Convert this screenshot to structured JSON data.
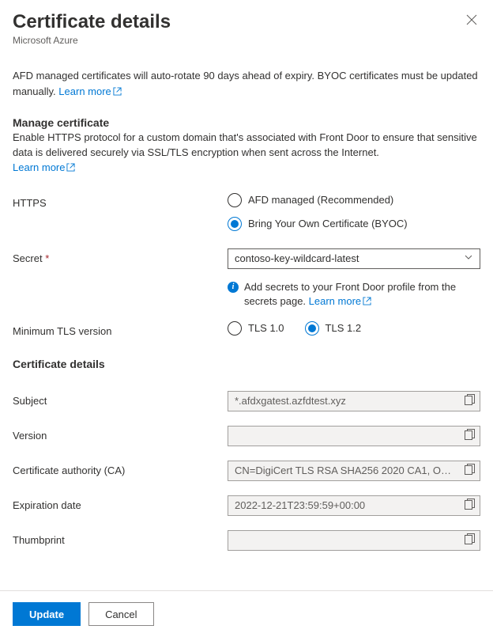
{
  "header": {
    "title": "Certificate details",
    "subtitle": "Microsoft Azure"
  },
  "intro": {
    "text": "AFD managed certificates will auto-rotate 90 days ahead of expiry. BYOC certificates must be updated manually. ",
    "learn_more": "Learn more"
  },
  "manage": {
    "heading": "Manage certificate",
    "desc": "Enable HTTPS protocol for a custom domain that's associated with Front Door to ensure that sensitive data is delivered securely via SSL/TLS encryption when sent across the Internet.",
    "learn_more": "Learn more"
  },
  "https": {
    "label": "HTTPS",
    "option_managed": "AFD managed (Recommended)",
    "option_byoc": "Bring Your Own Certificate (BYOC)",
    "selected": "byoc"
  },
  "secret": {
    "label": "Secret",
    "selected_value": "contoso-key-wildcard-latest",
    "info_text": "Add secrets to your Front Door profile from the secrets page. ",
    "learn_more": "Learn more"
  },
  "tls": {
    "label": "Minimum TLS version",
    "option_10": "TLS 1.0",
    "option_12": "TLS 1.2",
    "selected": "1.2"
  },
  "cert_details": {
    "heading": "Certificate details",
    "subject": {
      "label": "Subject",
      "value": "*.afdxgatest.azfdtest.xyz"
    },
    "version": {
      "label": "Version",
      "value": ""
    },
    "ca": {
      "label": "Certificate authority (CA)",
      "value": "CN=DigiCert TLS RSA SHA256 2020 CA1, O…"
    },
    "expiration": {
      "label": "Expiration date",
      "value": "2022-12-21T23:59:59+00:00"
    },
    "thumbprint": {
      "label": "Thumbprint",
      "value": ""
    }
  },
  "footer": {
    "update": "Update",
    "cancel": "Cancel"
  }
}
